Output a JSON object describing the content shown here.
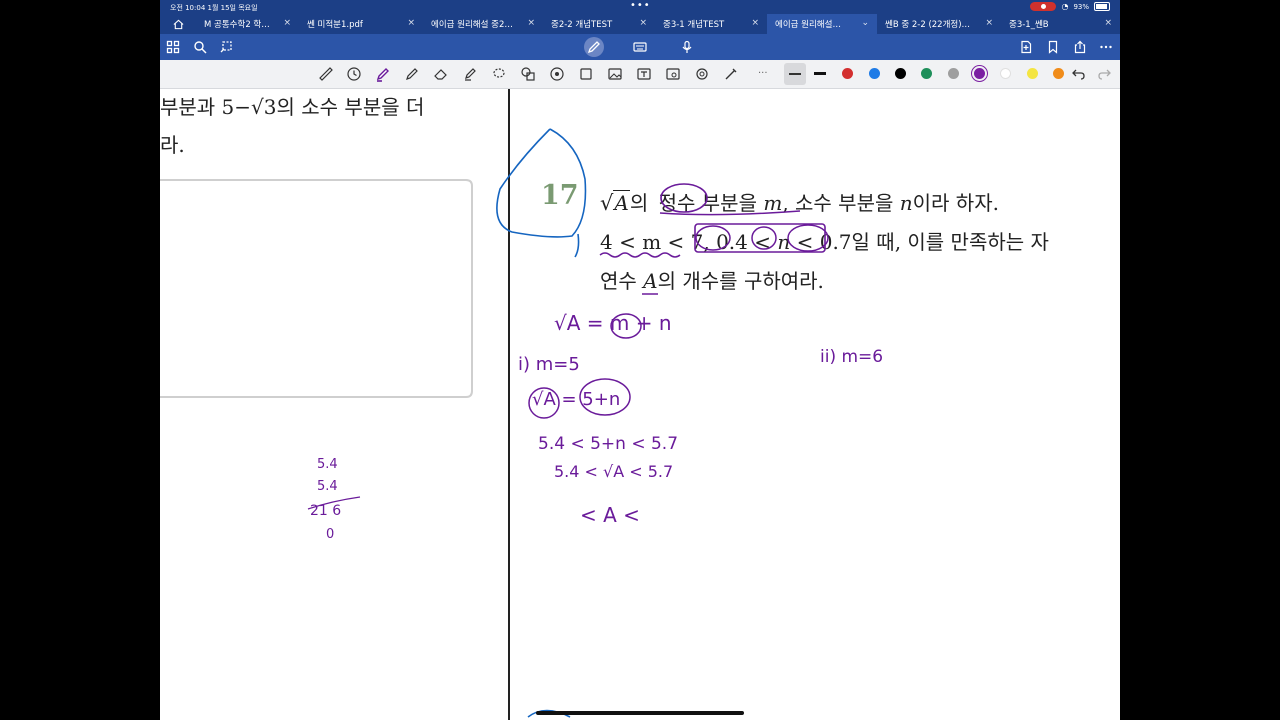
{
  "status": {
    "time": "오전 10:04   1월 15일 목요일",
    "battery": "93%"
  },
  "tabs": [
    {
      "label": "M 공통수학2 학…"
    },
    {
      "label": "쎈 미적분1.pdf"
    },
    {
      "label": "에이급 원리해설 중2…"
    },
    {
      "label": "중2-2 개념TEST"
    },
    {
      "label": "중3-1 개념TEST"
    },
    {
      "label": "에이급 원리해설…",
      "active": true
    },
    {
      "label": "쎈B 중 2-2 (22개정)…"
    },
    {
      "label": "중3-1_쎈B"
    }
  ],
  "colors": {
    "blue_bar": "#1c3f86",
    "toolbar": "#2c55a8",
    "swatches": [
      "#000000",
      "#d32f2f",
      "#1e7be6",
      "#000000",
      "#1e8f5a",
      "#9e9e9e",
      "#7b1fa2",
      "#ffffff",
      "#f4e542",
      "#f08c1a"
    ]
  },
  "left_page": {
    "line1": "부분과 5−√3의 소수 부분을 더",
    "line2": "라."
  },
  "problem": {
    "number": "17",
    "sqrtA": "A",
    "line1_a": "의",
    "line1_b": "정수",
    "line1_c": "부분을",
    "line1_m": "m",
    "line1_d": ", 소수 부분을",
    "line1_n": "n",
    "line1_e": "이라 하자.",
    "line2_ineq1": "4 < m < 7,",
    "line2_ineq2a": "0.4 <",
    "line2_n": "n",
    "line2_ineq2b": "< 0.7",
    "line2_rest": "일 때, 이를 만족하는 자",
    "line3_a": "연수",
    "line3_A": "A",
    "line3_b": "의 개수를 구하여라."
  },
  "handwriting": {
    "eq1": "√A = m + n",
    "case1": "i) m=5",
    "eq2": "√A = 5+n",
    "ineq1": "5.4 < 5+n < 5.7",
    "ineq2": "5.4 < √A < 5.7",
    "ineq3": "< A <",
    "case2": "ii) m=6",
    "calc1": "5.4",
    "calc2": "5.4",
    "calc3": "21 6",
    "calc4": "0"
  }
}
